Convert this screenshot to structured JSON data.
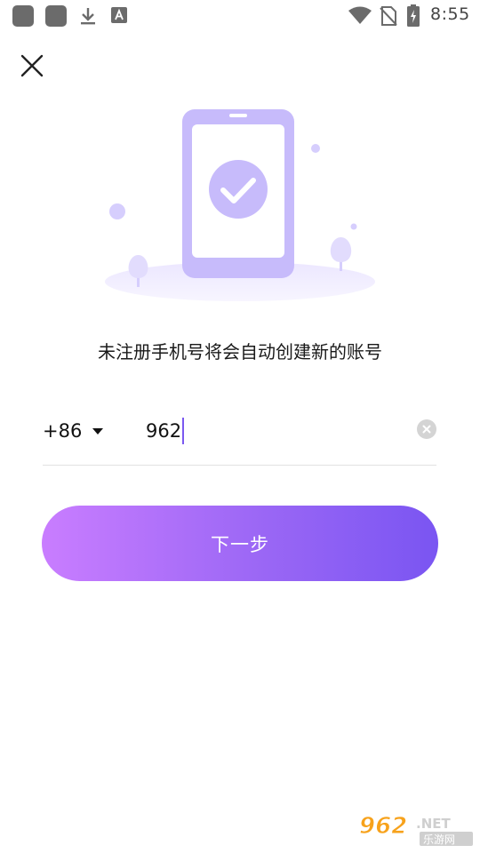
{
  "status_bar": {
    "time": "8:55",
    "icons": [
      "app-icon",
      "app-icon",
      "download-icon",
      "font-icon",
      "wifi-icon",
      "no-sim-icon",
      "battery-charging-icon"
    ]
  },
  "header": {
    "close_icon": "close-icon"
  },
  "illustration": {
    "icon": "phone-checkmark-illustration"
  },
  "tip": {
    "text": "未注册手机号将会自动创建新的账号"
  },
  "phone_form": {
    "country_code": "+86",
    "phone_value": "962"
  },
  "next_button": {
    "label": "下一步"
  },
  "watermark": {
    "brand": "962.NET",
    "subtitle": "乐游网"
  },
  "colors": {
    "accent_start": "#c97dff",
    "accent_end": "#7a55f2",
    "illustration": "#c7bbfb",
    "cursor": "#7b59f0"
  }
}
